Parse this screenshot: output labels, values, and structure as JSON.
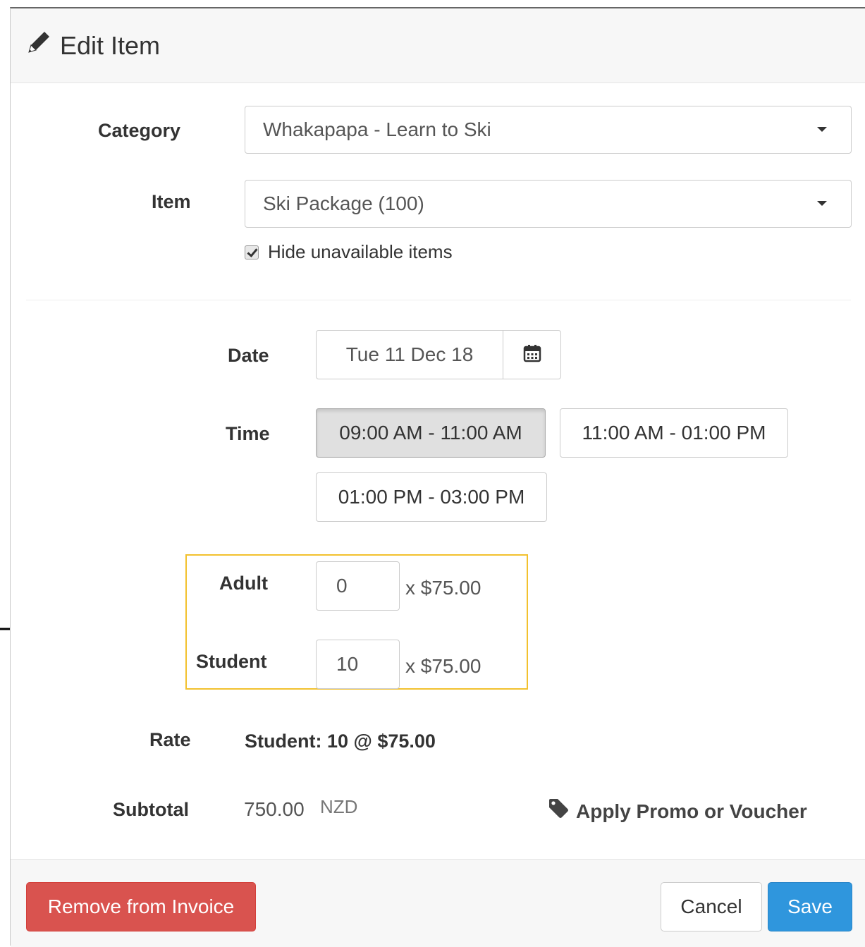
{
  "header": {
    "title": "Edit Item",
    "icon": "pencil-icon"
  },
  "form": {
    "category_label": "Category",
    "category_value": "Whakapapa - Learn to Ski",
    "item_label": "Item",
    "item_value": "Ski Package (100)",
    "hide_unavailable_label": "Hide unavailable items",
    "hide_unavailable_checked": true,
    "date_label": "Date",
    "date_value": "Tue 11 Dec 18",
    "time_label": "Time",
    "time_slots": [
      {
        "label": "09:00 AM - 11:00 AM",
        "selected": true
      },
      {
        "label": "11:00 AM - 01:00 PM",
        "selected": false
      },
      {
        "label": "01:00 PM - 03:00 PM",
        "selected": false
      }
    ],
    "quantities": [
      {
        "label": "Adult",
        "value": "0",
        "price": "x $75.00"
      },
      {
        "label": "Student",
        "value": "10",
        "price": "x $75.00"
      }
    ],
    "rate_label": "Rate",
    "rate_value": "Student: 10 @ $75.00",
    "subtotal_label": "Subtotal",
    "subtotal_amount": "750.00",
    "subtotal_currency": "NZD",
    "promo_label": "Apply Promo or Voucher"
  },
  "footer": {
    "remove_label": "Remove from Invoice",
    "cancel_label": "Cancel",
    "save_label": "Save"
  },
  "colors": {
    "danger": "#d9534f",
    "primary": "#2f96dd",
    "highlight": "#f2c12e"
  }
}
